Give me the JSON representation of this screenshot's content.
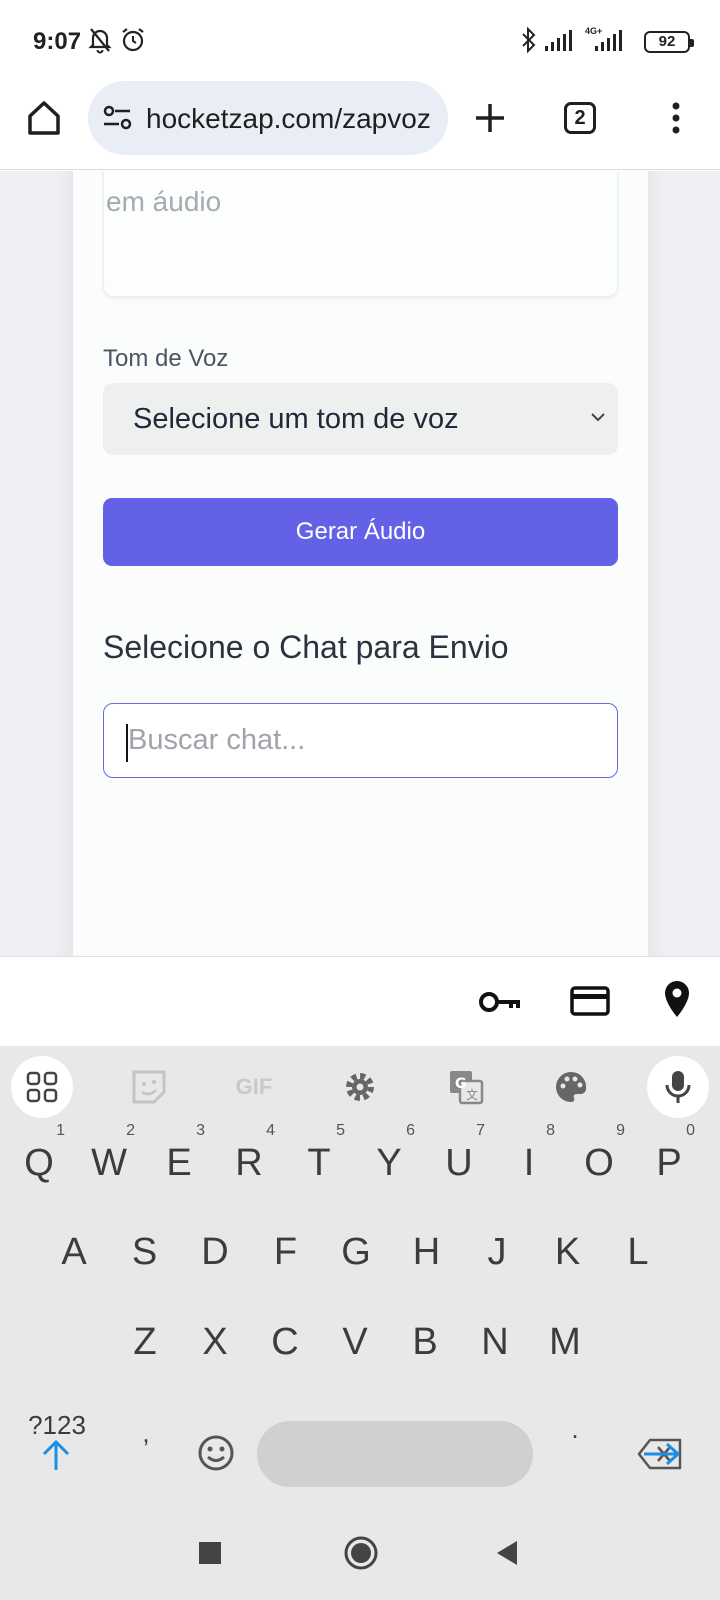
{
  "status_bar": {
    "time": "9:07",
    "battery": "92",
    "icons": [
      "bell-off-icon",
      "alarm-icon",
      "bluetooth-icon",
      "signal-icon",
      "signal-4g-icon",
      "battery-icon"
    ],
    "network_label": "4G+"
  },
  "browser": {
    "url": "hocketzap.com/zapvoz",
    "tab_count": "2",
    "icons": [
      "home-icon",
      "site-settings-icon",
      "new-tab-icon",
      "tab-switcher-icon",
      "more-menu-icon"
    ]
  },
  "form": {
    "textarea_placeholder_tail": "em áudio",
    "tone_label": "Tom de Voz",
    "tone_select_value": "Selecione um tom de voz",
    "generate_button": "Gerar Áudio",
    "chat_section_title": "Selecione o Chat para Envio",
    "chat_search_placeholder": "Buscar chat..."
  },
  "autofill_bar": {
    "icons": [
      "key-icon",
      "credit-card-icon",
      "location-pin-icon"
    ]
  },
  "keyboard": {
    "tools": [
      "apps-grid-icon",
      "sticker-icon",
      "GIF",
      "settings-icon",
      "translate-icon",
      "palette-icon",
      "mic-icon"
    ],
    "row1": [
      {
        "k": "Q",
        "n": "1"
      },
      {
        "k": "W",
        "n": "2"
      },
      {
        "k": "E",
        "n": "3"
      },
      {
        "k": "R",
        "n": "4"
      },
      {
        "k": "T",
        "n": "5"
      },
      {
        "k": "Y",
        "n": "6"
      },
      {
        "k": "U",
        "n": "7"
      },
      {
        "k": "I",
        "n": "8"
      },
      {
        "k": "O",
        "n": "9"
      },
      {
        "k": "P",
        "n": "0"
      }
    ],
    "row2": [
      "A",
      "S",
      "D",
      "F",
      "G",
      "H",
      "J",
      "K",
      "L"
    ],
    "row3": [
      "Z",
      "X",
      "C",
      "V",
      "B",
      "N",
      "M"
    ],
    "symbols_key": "?123",
    "comma_key": ",",
    "period_key": "."
  },
  "colors": {
    "accent": "#6361e6",
    "page_bg": "#eef0f4",
    "keyboard_bg": "#e8e8e8",
    "keyboard_blue": "#1a8fe3"
  }
}
